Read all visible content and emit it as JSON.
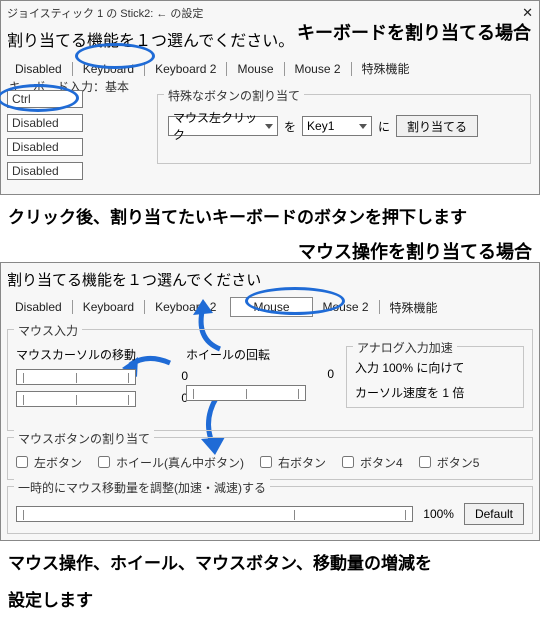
{
  "titlebar": "ジョイスティック 1 の Stick2: ← の設定",
  "prompt": "割り当てる機能を１つ選んでください。",
  "prompt2": "割り当てる機能を１つ選んでください",
  "tabs": {
    "disabled": "Disabled",
    "keyboard": "Keyboard",
    "keyboard2": "Keyboard 2",
    "mouse": "Mouse",
    "mouse2": "Mouse 2",
    "special": "特殊機能"
  },
  "kb": {
    "section": "キーボード入力：基本",
    "rows": [
      "Ctrl",
      "Disabled",
      "Disabled",
      "Disabled"
    ],
    "sp_label": "特殊なボタンの割り当て",
    "sp_sel1": "マウス左クリック",
    "sp_wo": "を",
    "sp_sel2": "Key1",
    "sp_ni": "に",
    "sp_btn": "割り当てる"
  },
  "cap_kb_head": "キーボードを割り当てる場合",
  "cap_kb_foot": "クリック後、割り当てたいキーボードのボタンを押下します",
  "cap_ms_head": "マウス操作を割り当てる場合",
  "cap_ms_foot1": "マウス操作、ホイール、マウスボタン、移動量の増減を",
  "cap_ms_foot2": "設定します",
  "mouse": {
    "section": "マウス入力",
    "cursor": "マウスカーソルの移動",
    "wheel": "ホイールの回転",
    "zero": "0",
    "accel_title": "アナログ入力加速",
    "accel_l1": "入力 100% に向けて",
    "accel_l2": "カーソル速度を 1 倍",
    "btns_label": "マウスボタンの割り当て",
    "b_left": "左ボタン",
    "b_wheel": "ホイール(真ん中ボタン)",
    "b_right": "右ボタン",
    "b4": "ボタン4",
    "b5": "ボタン5",
    "tmp_label": "一時的にマウス移動量を調整(加速・減速)する",
    "pct": "100%",
    "default": "Default"
  }
}
